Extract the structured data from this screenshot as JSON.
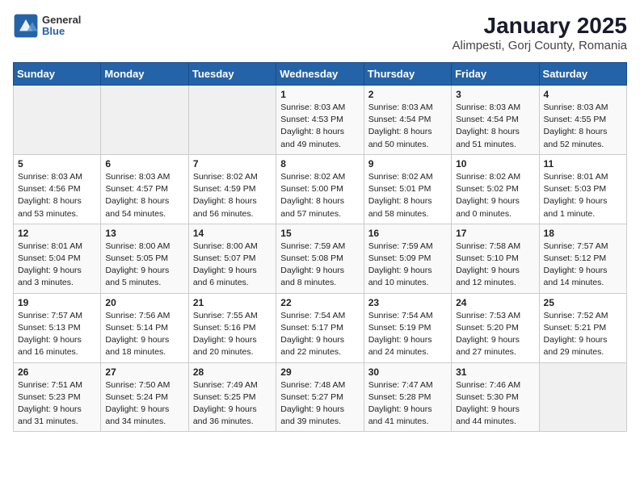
{
  "header": {
    "logo_line1": "General",
    "logo_line2": "Blue",
    "title": "January 2025",
    "subtitle": "Alimpesti, Gorj County, Romania"
  },
  "weekdays": [
    "Sunday",
    "Monday",
    "Tuesday",
    "Wednesday",
    "Thursday",
    "Friday",
    "Saturday"
  ],
  "weeks": [
    [
      {
        "day": "",
        "info": ""
      },
      {
        "day": "",
        "info": ""
      },
      {
        "day": "",
        "info": ""
      },
      {
        "day": "1",
        "info": "Sunrise: 8:03 AM\nSunset: 4:53 PM\nDaylight: 8 hours\nand 49 minutes."
      },
      {
        "day": "2",
        "info": "Sunrise: 8:03 AM\nSunset: 4:54 PM\nDaylight: 8 hours\nand 50 minutes."
      },
      {
        "day": "3",
        "info": "Sunrise: 8:03 AM\nSunset: 4:54 PM\nDaylight: 8 hours\nand 51 minutes."
      },
      {
        "day": "4",
        "info": "Sunrise: 8:03 AM\nSunset: 4:55 PM\nDaylight: 8 hours\nand 52 minutes."
      }
    ],
    [
      {
        "day": "5",
        "info": "Sunrise: 8:03 AM\nSunset: 4:56 PM\nDaylight: 8 hours\nand 53 minutes."
      },
      {
        "day": "6",
        "info": "Sunrise: 8:03 AM\nSunset: 4:57 PM\nDaylight: 8 hours\nand 54 minutes."
      },
      {
        "day": "7",
        "info": "Sunrise: 8:02 AM\nSunset: 4:59 PM\nDaylight: 8 hours\nand 56 minutes."
      },
      {
        "day": "8",
        "info": "Sunrise: 8:02 AM\nSunset: 5:00 PM\nDaylight: 8 hours\nand 57 minutes."
      },
      {
        "day": "9",
        "info": "Sunrise: 8:02 AM\nSunset: 5:01 PM\nDaylight: 8 hours\nand 58 minutes."
      },
      {
        "day": "10",
        "info": "Sunrise: 8:02 AM\nSunset: 5:02 PM\nDaylight: 9 hours\nand 0 minutes."
      },
      {
        "day": "11",
        "info": "Sunrise: 8:01 AM\nSunset: 5:03 PM\nDaylight: 9 hours\nand 1 minute."
      }
    ],
    [
      {
        "day": "12",
        "info": "Sunrise: 8:01 AM\nSunset: 5:04 PM\nDaylight: 9 hours\nand 3 minutes."
      },
      {
        "day": "13",
        "info": "Sunrise: 8:00 AM\nSunset: 5:05 PM\nDaylight: 9 hours\nand 5 minutes."
      },
      {
        "day": "14",
        "info": "Sunrise: 8:00 AM\nSunset: 5:07 PM\nDaylight: 9 hours\nand 6 minutes."
      },
      {
        "day": "15",
        "info": "Sunrise: 7:59 AM\nSunset: 5:08 PM\nDaylight: 9 hours\nand 8 minutes."
      },
      {
        "day": "16",
        "info": "Sunrise: 7:59 AM\nSunset: 5:09 PM\nDaylight: 9 hours\nand 10 minutes."
      },
      {
        "day": "17",
        "info": "Sunrise: 7:58 AM\nSunset: 5:10 PM\nDaylight: 9 hours\nand 12 minutes."
      },
      {
        "day": "18",
        "info": "Sunrise: 7:57 AM\nSunset: 5:12 PM\nDaylight: 9 hours\nand 14 minutes."
      }
    ],
    [
      {
        "day": "19",
        "info": "Sunrise: 7:57 AM\nSunset: 5:13 PM\nDaylight: 9 hours\nand 16 minutes."
      },
      {
        "day": "20",
        "info": "Sunrise: 7:56 AM\nSunset: 5:14 PM\nDaylight: 9 hours\nand 18 minutes."
      },
      {
        "day": "21",
        "info": "Sunrise: 7:55 AM\nSunset: 5:16 PM\nDaylight: 9 hours\nand 20 minutes."
      },
      {
        "day": "22",
        "info": "Sunrise: 7:54 AM\nSunset: 5:17 PM\nDaylight: 9 hours\nand 22 minutes."
      },
      {
        "day": "23",
        "info": "Sunrise: 7:54 AM\nSunset: 5:19 PM\nDaylight: 9 hours\nand 24 minutes."
      },
      {
        "day": "24",
        "info": "Sunrise: 7:53 AM\nSunset: 5:20 PM\nDaylight: 9 hours\nand 27 minutes."
      },
      {
        "day": "25",
        "info": "Sunrise: 7:52 AM\nSunset: 5:21 PM\nDaylight: 9 hours\nand 29 minutes."
      }
    ],
    [
      {
        "day": "26",
        "info": "Sunrise: 7:51 AM\nSunset: 5:23 PM\nDaylight: 9 hours\nand 31 minutes."
      },
      {
        "day": "27",
        "info": "Sunrise: 7:50 AM\nSunset: 5:24 PM\nDaylight: 9 hours\nand 34 minutes."
      },
      {
        "day": "28",
        "info": "Sunrise: 7:49 AM\nSunset: 5:25 PM\nDaylight: 9 hours\nand 36 minutes."
      },
      {
        "day": "29",
        "info": "Sunrise: 7:48 AM\nSunset: 5:27 PM\nDaylight: 9 hours\nand 39 minutes."
      },
      {
        "day": "30",
        "info": "Sunrise: 7:47 AM\nSunset: 5:28 PM\nDaylight: 9 hours\nand 41 minutes."
      },
      {
        "day": "31",
        "info": "Sunrise: 7:46 AM\nSunset: 5:30 PM\nDaylight: 9 hours\nand 44 minutes."
      },
      {
        "day": "",
        "info": ""
      }
    ]
  ]
}
